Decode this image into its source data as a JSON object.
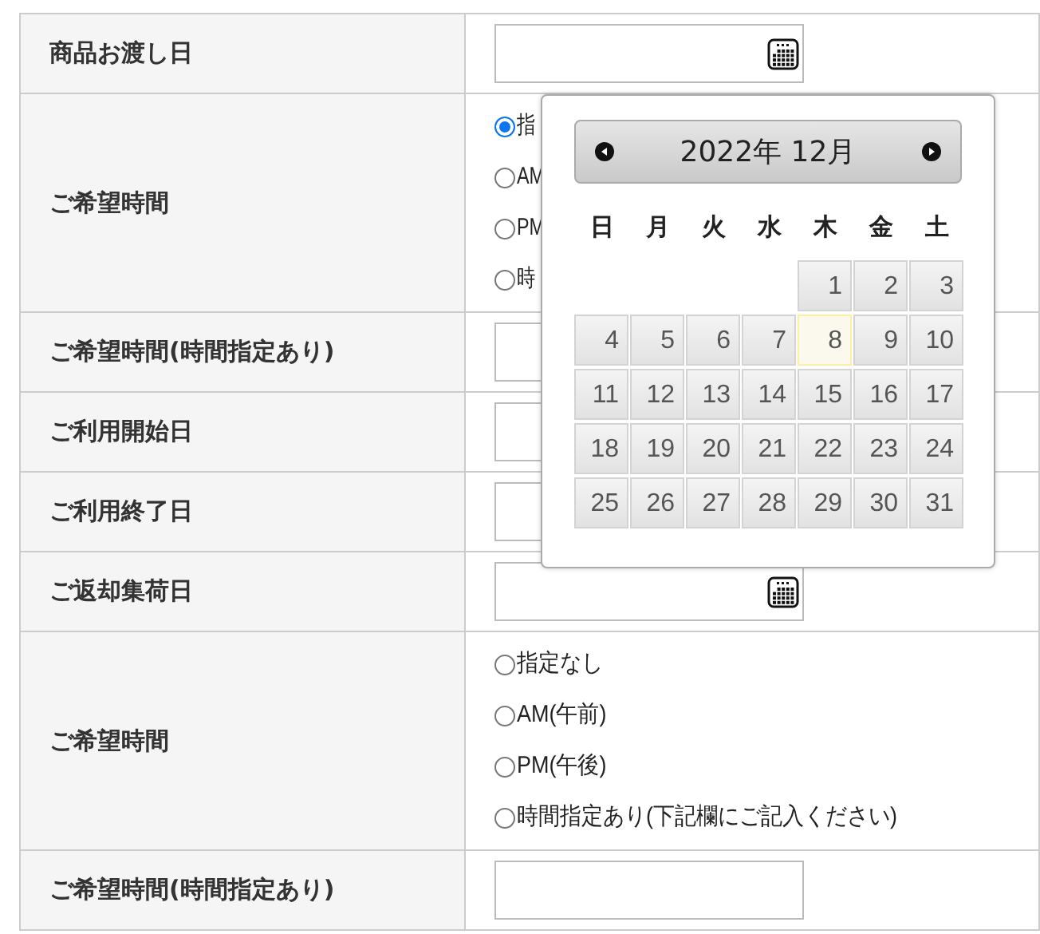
{
  "form_rows": [
    {
      "label": "商品お渡し日",
      "kind": "date"
    },
    {
      "label": "ご希望時間",
      "kind": "radio",
      "options": [
        {
          "label": "指",
          "selected": true
        },
        {
          "label": "AM",
          "selected": false
        },
        {
          "label": "PM",
          "selected": false
        },
        {
          "label": "時",
          "selected": false
        }
      ]
    },
    {
      "label": "ご希望時間(時間指定あり)",
      "kind": "text"
    },
    {
      "label": "ご利用開始日",
      "kind": "date_hidden"
    },
    {
      "label": "ご利用終了日",
      "kind": "date_hidden"
    },
    {
      "label": "ご返却集荷日",
      "kind": "date"
    },
    {
      "label": "ご希望時間",
      "kind": "radio",
      "options": [
        {
          "label": "指定なし",
          "selected": false
        },
        {
          "label": "AM(午前)",
          "selected": false
        },
        {
          "label": "PM(午後)",
          "selected": false
        },
        {
          "label": "時間指定あり(下記欄にご記入ください)",
          "selected": false
        }
      ]
    },
    {
      "label": "ご希望時間(時間指定あり)",
      "kind": "text"
    }
  ],
  "calendar": {
    "title": "2022年 12月",
    "weekdays": [
      "日",
      "月",
      "火",
      "水",
      "木",
      "金",
      "土"
    ],
    "weeks": [
      [
        {
          "day": "1",
          "today": false
        },
        {
          "day": "2",
          "today": false
        },
        {
          "day": "3",
          "today": false
        }
      ],
      [
        {
          "day": "4",
          "today": false
        },
        {
          "day": "5",
          "today": false
        },
        {
          "day": "6",
          "today": false
        },
        {
          "day": "7",
          "today": false
        },
        {
          "day": "8",
          "today": true
        },
        {
          "day": "9",
          "today": false
        },
        {
          "day": "10",
          "today": false
        }
      ],
      [
        {
          "day": "11",
          "today": false
        },
        {
          "day": "12",
          "today": false
        },
        {
          "day": "13",
          "today": false
        },
        {
          "day": "14",
          "today": false
        },
        {
          "day": "15",
          "today": false
        },
        {
          "day": "16",
          "today": false
        },
        {
          "day": "17",
          "today": false
        }
      ],
      [
        {
          "day": "18",
          "today": false
        },
        {
          "day": "19",
          "today": false
        },
        {
          "day": "20",
          "today": false
        },
        {
          "day": "21",
          "today": false
        },
        {
          "day": "22",
          "today": false
        },
        {
          "day": "23",
          "today": false
        },
        {
          "day": "24",
          "today": false
        }
      ],
      [
        {
          "day": "25",
          "today": false
        },
        {
          "day": "26",
          "today": false
        },
        {
          "day": "27",
          "today": false
        },
        {
          "day": "28",
          "today": false
        },
        {
          "day": "29",
          "today": false
        },
        {
          "day": "30",
          "today": false
        },
        {
          "day": "31",
          "today": false
        }
      ]
    ]
  }
}
